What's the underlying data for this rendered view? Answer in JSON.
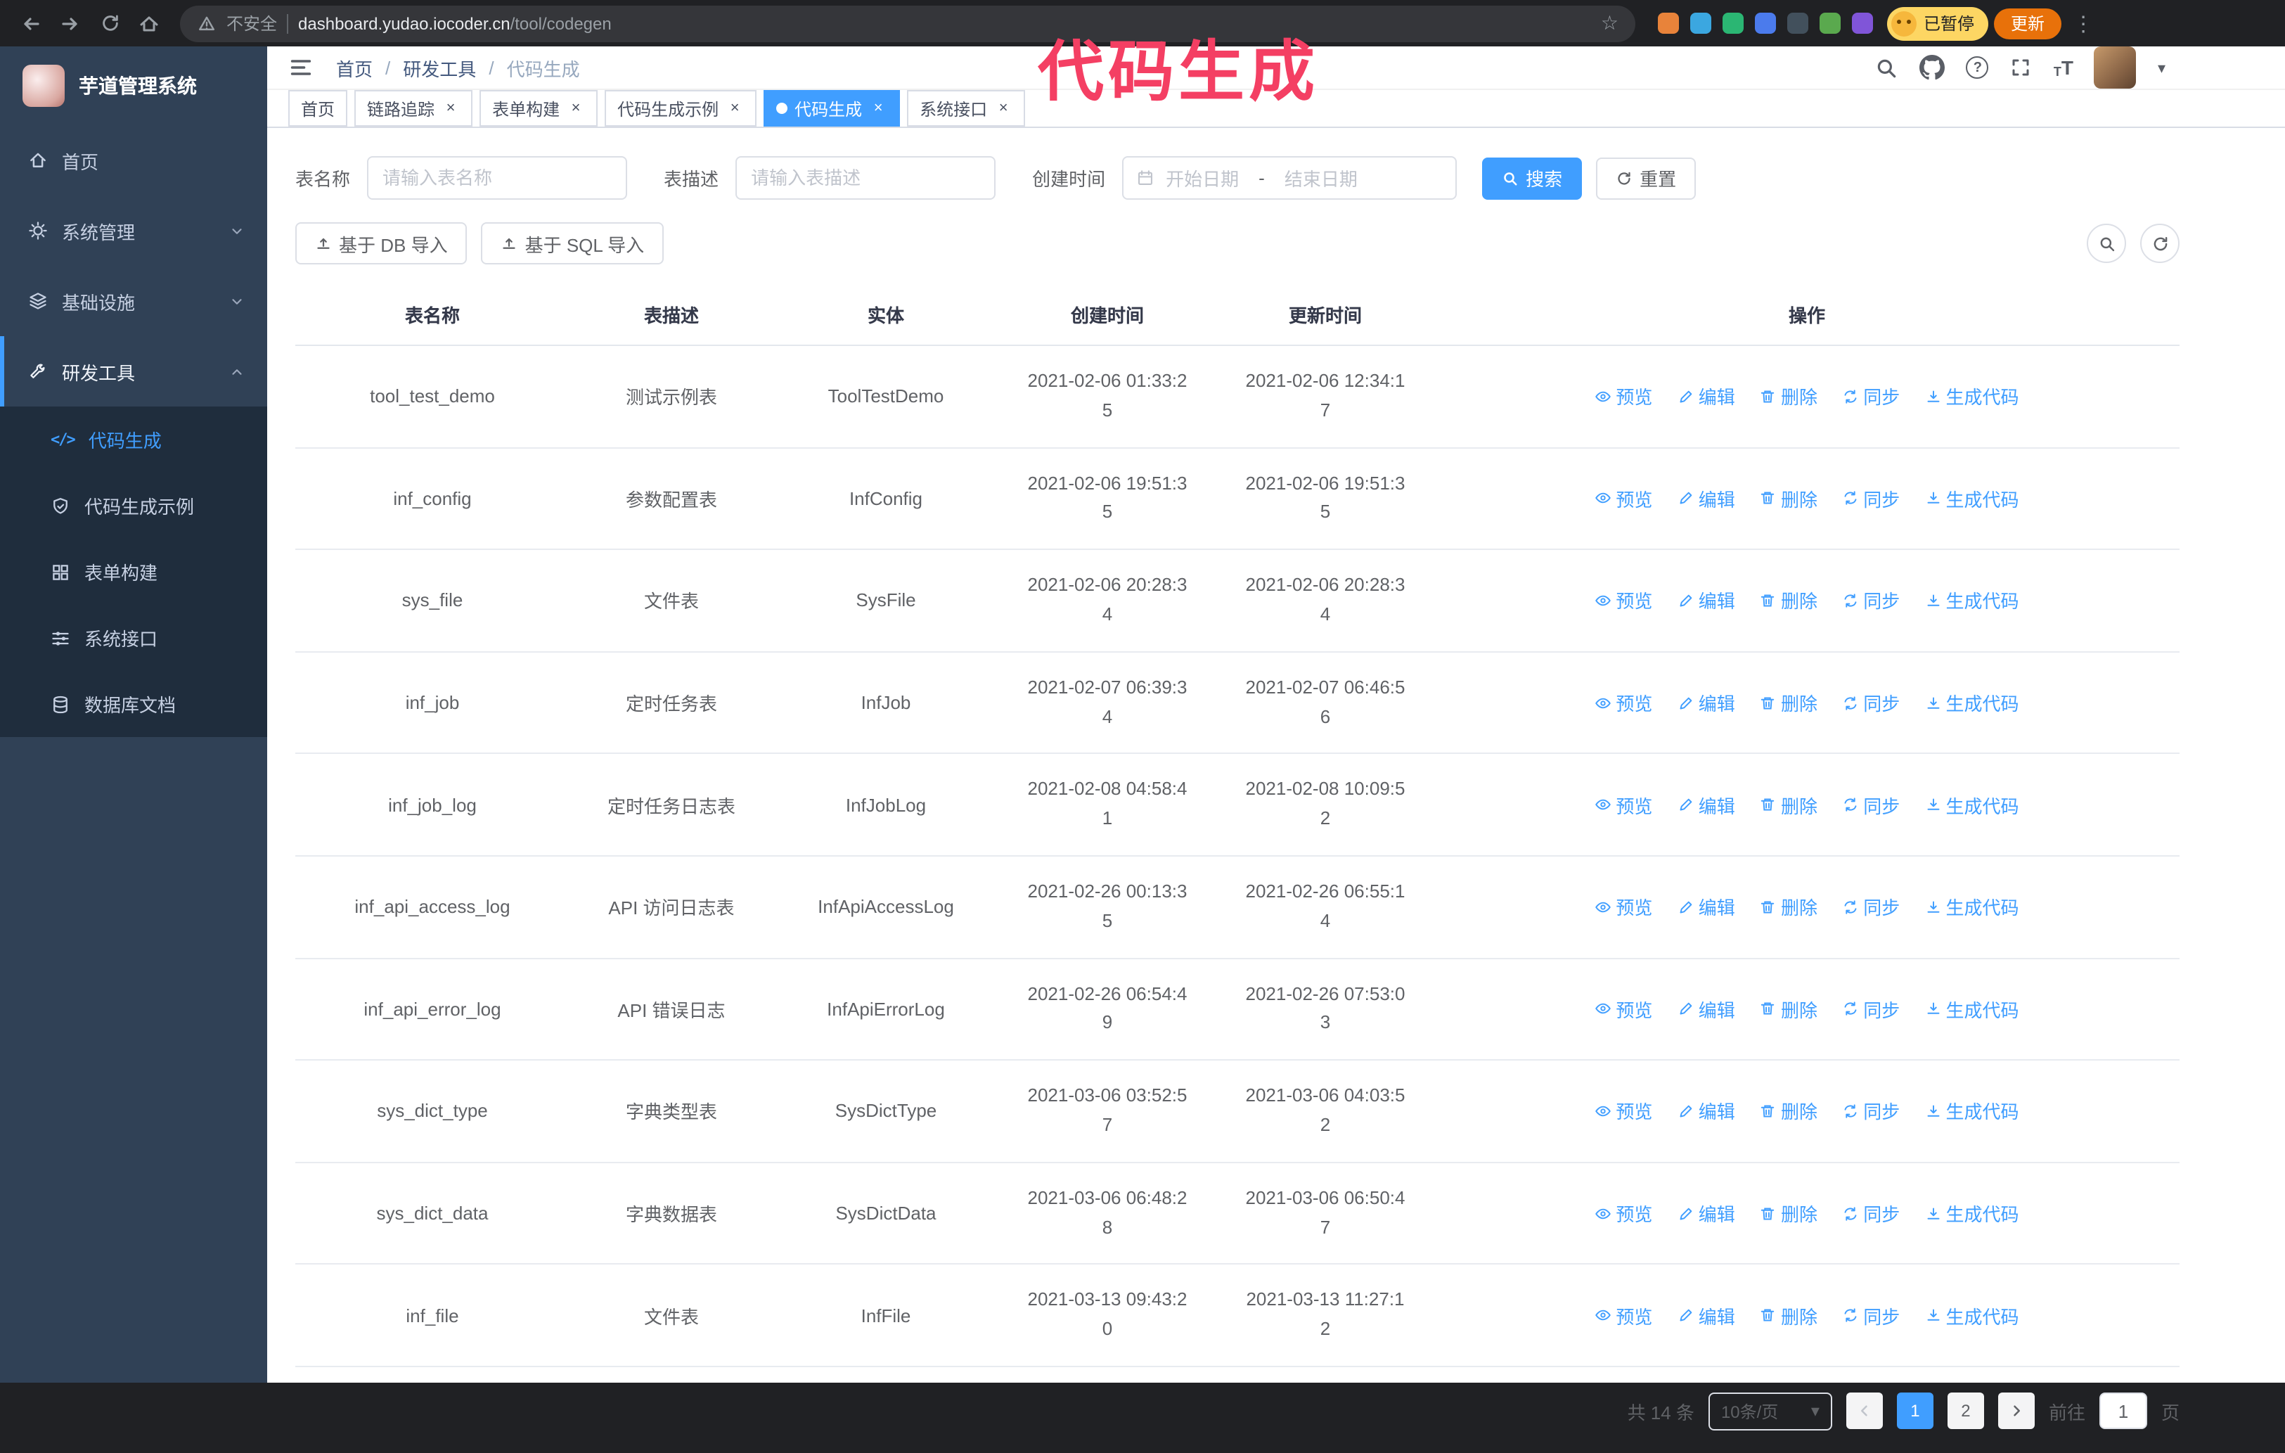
{
  "annotation": "代码生成",
  "glyphs": {
    "star": "☆",
    "menu_dots": "⋮",
    "caret_down": "▾",
    "question": "?",
    "separator": "/",
    "code": "</>",
    "t_big": "T",
    "t_small": "T"
  },
  "browser": {
    "security_label": "不安全",
    "url_host": "dashboard.yudao.iocoder.cn",
    "url_path": "/tool/codegen",
    "profile_badge": "已暂停",
    "update_button": "更新",
    "extension_colors": [
      "#e8833a",
      "#3ba7e0",
      "#2bb673",
      "#4b7bec",
      "#42505c",
      "#5aa94e",
      "#8055d8"
    ]
  },
  "sidebar": {
    "logo_title": "芋道管理系统",
    "items": [
      {
        "label": "首页"
      },
      {
        "label": "系统管理"
      },
      {
        "label": "基础设施"
      },
      {
        "label": "研发工具"
      }
    ],
    "sub_items": [
      {
        "label": "代码生成"
      },
      {
        "label": "代码生成示例"
      },
      {
        "label": "表单构建"
      },
      {
        "label": "系统接口"
      },
      {
        "label": "数据库文档"
      }
    ]
  },
  "header": {
    "breadcrumb": [
      "首页",
      "研发工具",
      "代码生成"
    ]
  },
  "tabs": [
    {
      "label": "首页"
    },
    {
      "label": "链路追踪"
    },
    {
      "label": "表单构建"
    },
    {
      "label": "代码生成示例"
    },
    {
      "label": "代码生成"
    },
    {
      "label": "系统接口"
    }
  ],
  "filters": {
    "table_name_label": "表名称",
    "table_name_placeholder": "请输入表名称",
    "table_desc_label": "表描述",
    "table_desc_placeholder": "请输入表描述",
    "create_time_label": "创建时间",
    "date_start_placeholder": "开始日期",
    "date_separator": "-",
    "date_end_placeholder": "结束日期",
    "search_button": "搜索",
    "reset_button": "重置"
  },
  "toolbar": {
    "import_db_label": "基于 DB 导入",
    "import_sql_label": "基于 SQL 导入"
  },
  "table": {
    "columns": [
      "表名称",
      "表描述",
      "实体",
      "创建时间",
      "更新时间",
      "操作"
    ],
    "actions": [
      "预览",
      "编辑",
      "删除",
      "同步",
      "生成代码"
    ],
    "rows": [
      {
        "name": "tool_test_demo",
        "desc": "测试示例表",
        "entity": "ToolTestDemo",
        "created": "2021-02-06 01:33:25",
        "updated": "2021-02-06 12:34:17"
      },
      {
        "name": "inf_config",
        "desc": "参数配置表",
        "entity": "InfConfig",
        "created": "2021-02-06 19:51:35",
        "updated": "2021-02-06 19:51:35"
      },
      {
        "name": "sys_file",
        "desc": "文件表",
        "entity": "SysFile",
        "created": "2021-02-06 20:28:34",
        "updated": "2021-02-06 20:28:34"
      },
      {
        "name": "inf_job",
        "desc": "定时任务表",
        "entity": "InfJob",
        "created": "2021-02-07 06:39:34",
        "updated": "2021-02-07 06:46:56"
      },
      {
        "name": "inf_job_log",
        "desc": "定时任务日志表",
        "entity": "InfJobLog",
        "created": "2021-02-08 04:58:41",
        "updated": "2021-02-08 10:09:52"
      },
      {
        "name": "inf_api_access_log",
        "desc": "API 访问日志表",
        "entity": "InfApiAccessLog",
        "created": "2021-02-26 00:13:35",
        "updated": "2021-02-26 06:55:14"
      },
      {
        "name": "inf_api_error_log",
        "desc": "API 错误日志",
        "entity": "InfApiErrorLog",
        "created": "2021-02-26 06:54:49",
        "updated": "2021-02-26 07:53:03"
      },
      {
        "name": "sys_dict_type",
        "desc": "字典类型表",
        "entity": "SysDictType",
        "created": "2021-03-06 03:52:57",
        "updated": "2021-03-06 04:03:52"
      },
      {
        "name": "sys_dict_data",
        "desc": "字典数据表",
        "entity": "SysDictData",
        "created": "2021-03-06 06:48:28",
        "updated": "2021-03-06 06:50:47"
      },
      {
        "name": "inf_file",
        "desc": "文件表",
        "entity": "InfFile",
        "created": "2021-03-13 09:43:20",
        "updated": "2021-03-13 11:27:12"
      }
    ]
  },
  "pagination": {
    "total_label": "共 14 条",
    "page_size": "10条/页",
    "pages": [
      "1",
      "2"
    ],
    "goto_label": "前往",
    "goto_value": "1",
    "goto_suffix": "页"
  }
}
